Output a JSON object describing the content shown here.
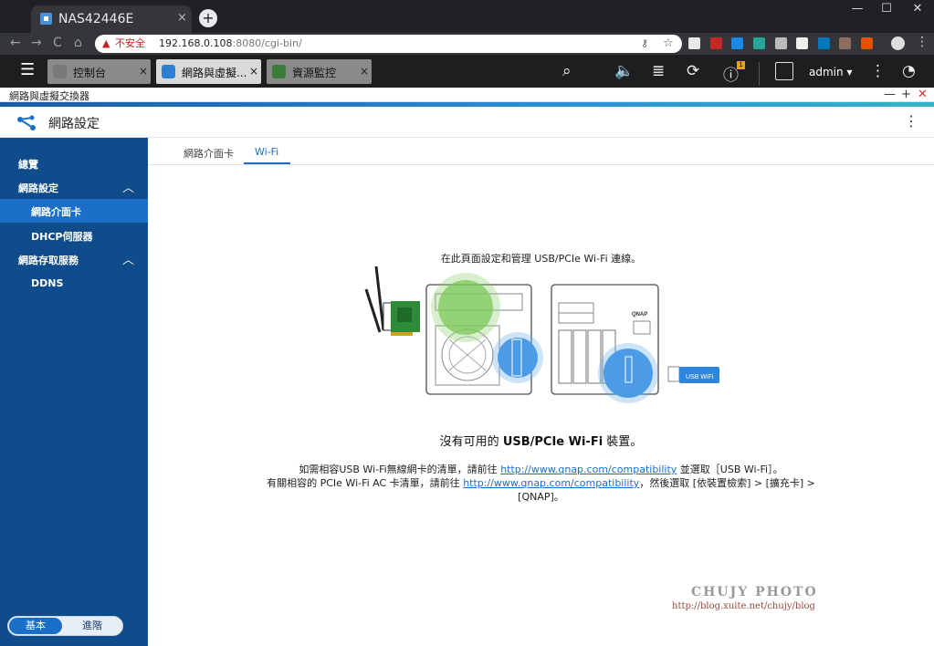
{
  "browser": {
    "tab_title": "NAS42446E",
    "tab_close": "×",
    "new_tab": "+",
    "window_controls": [
      "—",
      "☐",
      "✕"
    ],
    "nav": [
      "←",
      "→",
      "C",
      "⌂"
    ],
    "insecure_label": "不安全",
    "url_host": "192.168.0.108",
    "url_path": ":8080/cgi-bin/"
  },
  "qts": {
    "tabs": [
      {
        "label": "控制台",
        "icon_color": "#7a7a7a"
      },
      {
        "label": "網路與虛擬...",
        "icon_color": "#2d7fd3"
      },
      {
        "label": "資源監控",
        "icon_color": "#3a7d3a"
      }
    ],
    "close_glyph": "×",
    "user": "admin",
    "user_caret": "▾",
    "notification_badge": "1"
  },
  "app": {
    "window_title": "網路與虛擬交換器",
    "window_controls": [
      "—",
      "+",
      "✕"
    ],
    "header_title": "網路設定",
    "more_glyph": "⋮",
    "accent_color": "#1c6fc6",
    "sidebar_color": "#0f4c8c"
  },
  "sidebar": {
    "items": [
      {
        "label": "總覽"
      },
      {
        "label": "網路設定",
        "chevron": "︿"
      },
      {
        "label": "網路介面卡"
      },
      {
        "label": "DHCP伺服器"
      },
      {
        "label": "網路存取服務",
        "chevron": "︿"
      },
      {
        "label": "DDNS"
      }
    ],
    "mode_basic": "基本",
    "mode_advanced": "進階"
  },
  "content": {
    "tabs": [
      "網路介面卡",
      "Wi-Fi"
    ],
    "intro": "在此頁面設定和管理 USB/PCIe Wi-Fi 連線。",
    "no_device_prefix": "沒有可用的 ",
    "no_device_bold": "USB/PCIe Wi-Fi",
    "no_device_suffix": " 裝置。",
    "usb_label": "USB WiFi",
    "qnap_logo": "QNAP",
    "line1_pre": "如需相容USB Wi-Fi無線網卡的清單，請前往 ",
    "line1_link": "http://www.qnap.com/compatibility",
    "line1_post": " 並選取［USB Wi-Fi］。",
    "line2_pre": "有關相容的 PCIe Wi-Fi AC 卡清單，請前往 ",
    "line2_link": "http://www.qnap.com/compatibility",
    "line2_post": "，然後選取 [依裝置檢索] > [擴充卡] >",
    "line3": "[QNAP]。"
  },
  "watermark": {
    "name": "CHUJY PHOTO",
    "url": "http://blog.xuite.net/chujy/blog"
  }
}
